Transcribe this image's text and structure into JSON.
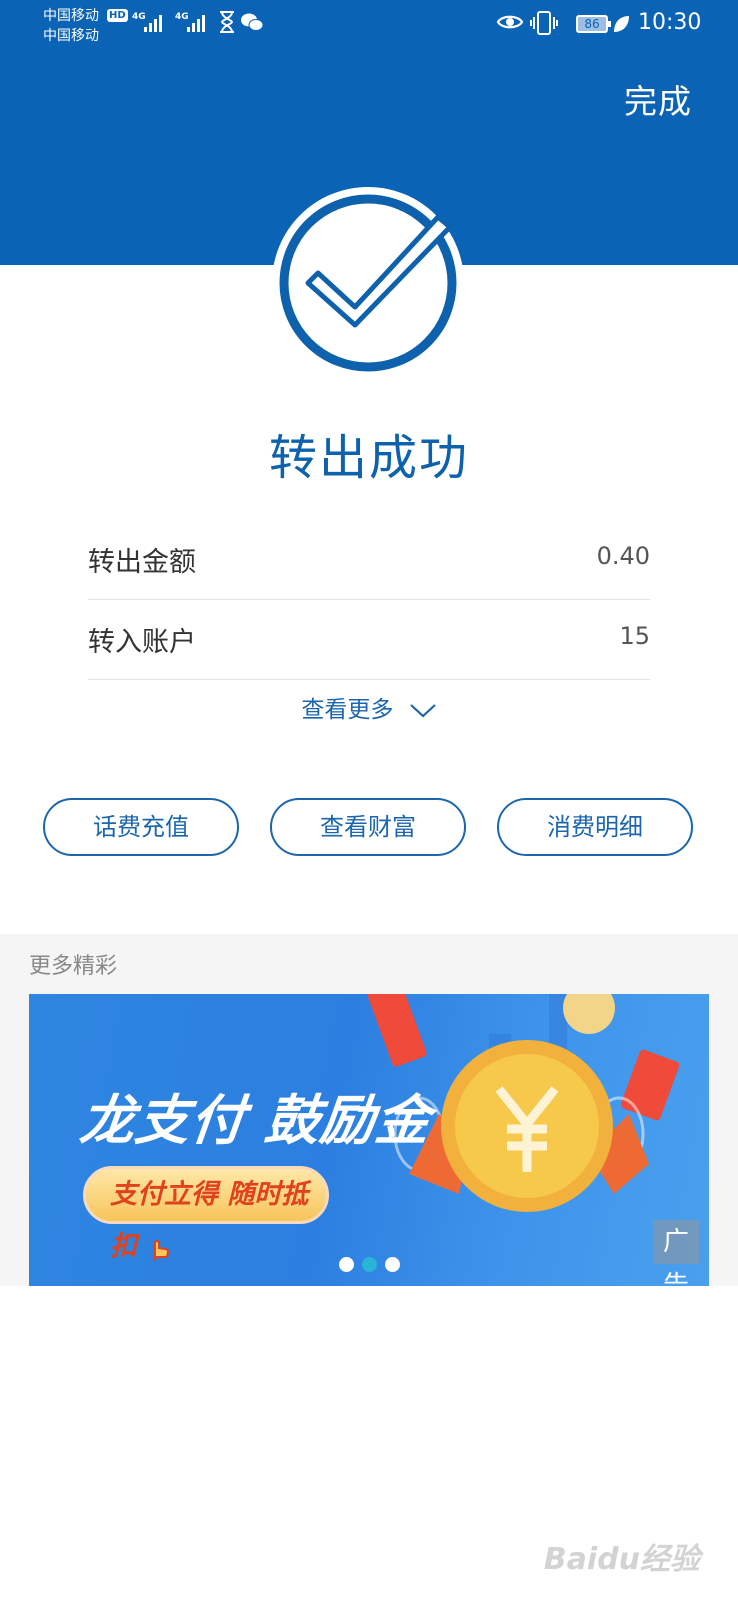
{
  "status_bar": {
    "carrier_1": "中国移动",
    "carrier_2": "中国移动",
    "hd_badge": "HD",
    "network_1": "4G",
    "network_2": "4G",
    "battery": "86",
    "time": "10:30"
  },
  "header": {
    "done_label": "完成"
  },
  "result": {
    "title": "转出成功"
  },
  "details": [
    {
      "label": "转出金额",
      "value": "0.40"
    },
    {
      "label": "转入账户",
      "value": "15"
    }
  ],
  "view_more_label": "查看更多",
  "actions": [
    {
      "label": "话费充值"
    },
    {
      "label": "查看财富"
    },
    {
      "label": "消费明细"
    }
  ],
  "more_section": {
    "title": "更多精彩"
  },
  "banner": {
    "title": "龙支付 鼓励金",
    "subtitle": "支付立得 随时抵扣",
    "ad_label": "广告",
    "slide_count": 3,
    "active_slide": 2
  },
  "watermark": "Baidu经验",
  "colors": {
    "primary": "#0a63b5",
    "accent_text": "#1b66ac"
  }
}
